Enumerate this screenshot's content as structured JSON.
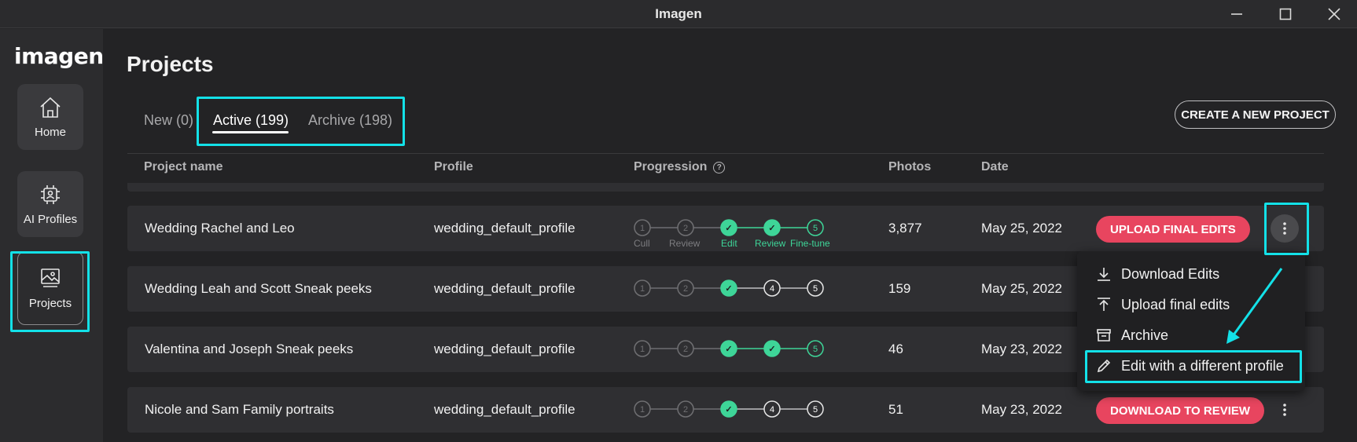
{
  "window": {
    "title": "Imagen"
  },
  "sidebar": {
    "logo": "imagen",
    "items": [
      {
        "label": "Home",
        "icon": "home-icon"
      },
      {
        "label": "AI Profiles",
        "icon": "ai-chip-icon"
      },
      {
        "label": "Projects",
        "icon": "projects-image-icon",
        "active": true
      }
    ]
  },
  "main": {
    "title": "Projects",
    "tabs": [
      {
        "label": "New (0)"
      },
      {
        "label": "Active (199)",
        "active": true
      },
      {
        "label": "Archive (198)"
      }
    ],
    "create_button": "CREATE A NEW PROJECT",
    "columns": [
      "Project name",
      "Profile",
      "Progression",
      "Photos",
      "Date"
    ],
    "step_labels": [
      "Cull",
      "Review",
      "Edit",
      "Review",
      "Fine-tune"
    ],
    "rows": [
      {
        "name": "Wedding Rachel and Leo",
        "profile": "wedding_default_profile",
        "steps": [
          "1",
          "2",
          "✓",
          "✓",
          "5"
        ],
        "photos": "3,877",
        "date": "May 25, 2022",
        "action": "UPLOAD FINAL EDITS"
      },
      {
        "name": "Wedding Leah and Scott Sneak peeks",
        "profile": "wedding_default_profile",
        "steps": [
          "1",
          "2",
          "✓",
          "4",
          "5"
        ],
        "photos": "159",
        "date": "May 25, 2022",
        "action": ""
      },
      {
        "name": "Valentina and Joseph Sneak peeks",
        "profile": "wedding_default_profile",
        "steps": [
          "1",
          "2",
          "✓",
          "✓",
          "5"
        ],
        "photos": "46",
        "date": "May 23, 2022",
        "action": ""
      },
      {
        "name": "Nicole and Sam Family portraits",
        "profile": "wedding_default_profile",
        "steps": [
          "1",
          "2",
          "✓",
          "4",
          "5"
        ],
        "photos": "51",
        "date": "May 23, 2022",
        "action": "DOWNLOAD TO REVIEW"
      }
    ]
  },
  "context_menu": {
    "items": [
      {
        "label": "Download Edits",
        "icon": "download-icon"
      },
      {
        "label": "Upload final edits",
        "icon": "upload-icon"
      },
      {
        "label": "Archive",
        "icon": "archive-icon"
      },
      {
        "label": "Edit with a different profile",
        "icon": "pencil-icon"
      }
    ]
  },
  "colors": {
    "accent_pink": "#e8455f",
    "progress_green": "#3ed598",
    "highlight_cyan": "#13e1e8",
    "background": "#232325"
  }
}
